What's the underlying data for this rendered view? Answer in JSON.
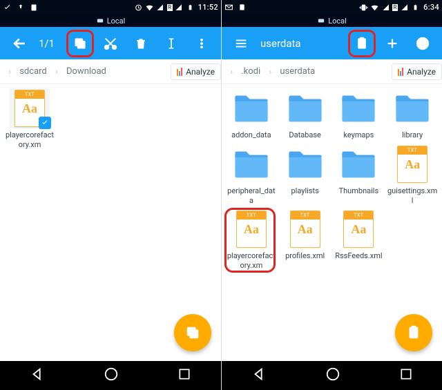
{
  "left": {
    "statusbar": {
      "time": "11:52"
    },
    "localbar": {
      "label": "Local"
    },
    "toolbar": {
      "counter": "1/1"
    },
    "breadcrumb": {
      "items": [
        "sdcard",
        "Download"
      ],
      "analyze": "Analyze"
    },
    "files": [
      {
        "name": "playercorefactory.xm",
        "type": "txt",
        "badge": "TXT",
        "aa": "Aa",
        "selected": true
      }
    ],
    "fab": {
      "icon": "copy"
    }
  },
  "right": {
    "statusbar": {
      "time": "6:34"
    },
    "localbar": {
      "label": "Local"
    },
    "toolbar": {
      "title": "userdata"
    },
    "breadcrumb": {
      "items": [
        ".kodi",
        "userdata"
      ],
      "analyze": "Analyze"
    },
    "files": [
      {
        "name": "addon_data",
        "type": "folder"
      },
      {
        "name": "Database",
        "type": "folder"
      },
      {
        "name": "keymaps",
        "type": "folder"
      },
      {
        "name": "library",
        "type": "folder"
      },
      {
        "name": "peripheral_data",
        "type": "folder"
      },
      {
        "name": "playlists",
        "type": "folder"
      },
      {
        "name": "Thumbnails",
        "type": "folder"
      },
      {
        "name": "guisettings.xml",
        "type": "txt",
        "badge": "TXT",
        "aa": "Aa"
      },
      {
        "name": "playercorefactory.xm",
        "type": "txt",
        "badge": "TXT",
        "aa": "Aa",
        "callout": true
      },
      {
        "name": "profiles.xml",
        "type": "txt",
        "badge": "TXT",
        "aa": "Aa"
      },
      {
        "name": "RssFeeds.xml",
        "type": "txt",
        "badge": "TXT",
        "aa": "Aa"
      }
    ],
    "fab": {
      "icon": "paste"
    }
  }
}
